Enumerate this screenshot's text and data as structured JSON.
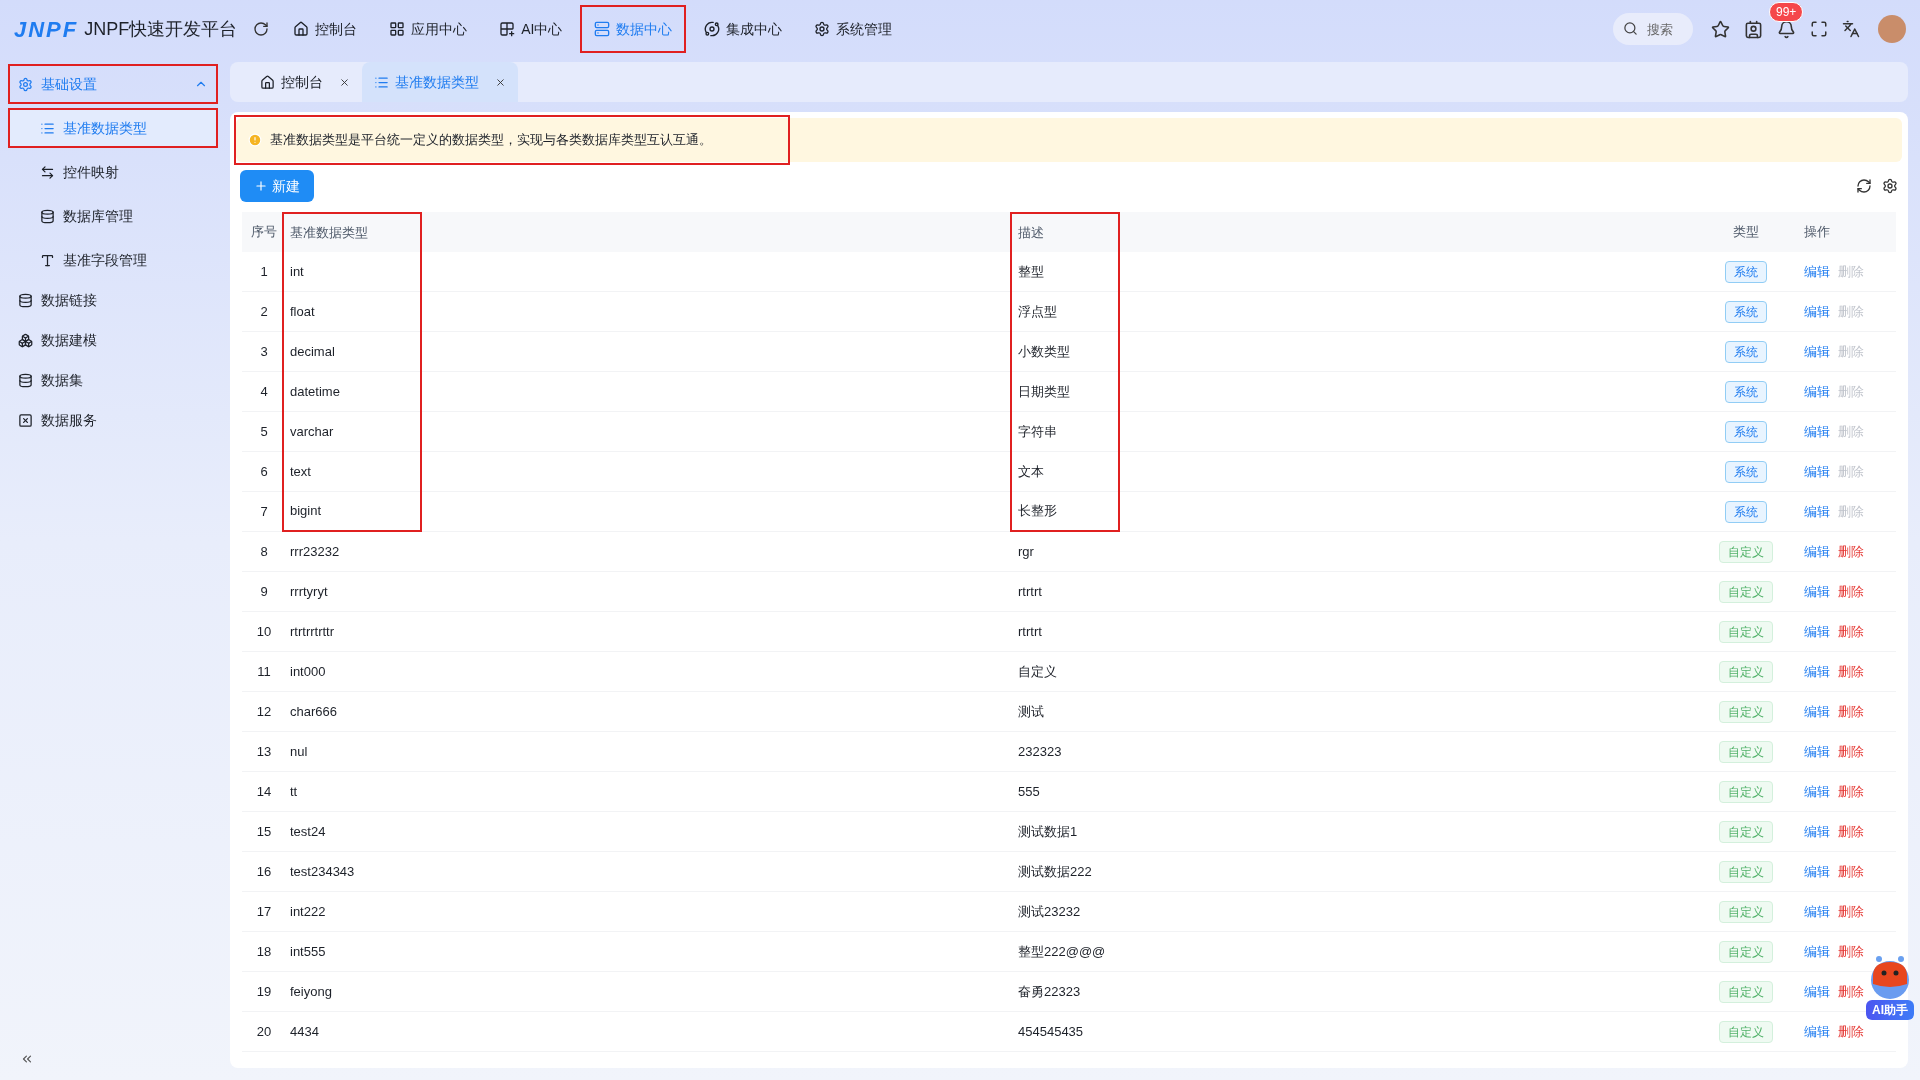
{
  "header": {
    "logo_text": "JNPF",
    "title": "JNPF快速开发平台",
    "search": {
      "placeholder": "搜索"
    },
    "notification_badge": "99+"
  },
  "nav": [
    {
      "label": "控制台",
      "selected": false,
      "highlighted": false
    },
    {
      "label": "应用中心",
      "selected": false,
      "highlighted": false
    },
    {
      "label": "AI中心",
      "selected": false,
      "highlighted": false
    },
    {
      "label": "数据中心",
      "selected": true,
      "highlighted": true
    },
    {
      "label": "集成中心",
      "selected": false,
      "highlighted": false
    },
    {
      "label": "系统管理",
      "selected": false,
      "highlighted": false
    }
  ],
  "sidebar": {
    "items": [
      {
        "label": "基础设置",
        "expanded": true,
        "highlighted": true,
        "children": [
          {
            "label": "基准数据类型",
            "selected": true,
            "highlighted": true
          },
          {
            "label": "控件映射",
            "selected": false,
            "highlighted": false
          },
          {
            "label": "数据库管理",
            "selected": false,
            "highlighted": false
          },
          {
            "label": "基准字段管理",
            "selected": false,
            "highlighted": false
          }
        ]
      },
      {
        "label": "数据链接",
        "highlighted": false
      },
      {
        "label": "数据建模",
        "highlighted": false
      },
      {
        "label": "数据集",
        "highlighted": false
      },
      {
        "label": "数据服务",
        "highlighted": false
      }
    ]
  },
  "tabs": [
    {
      "label": "控制台",
      "selected": false
    },
    {
      "label": "基准数据类型",
      "selected": true
    }
  ],
  "notice": {
    "text": "基准数据类型是平台统一定义的数据类型，实现与各类数据库类型互认互通。",
    "highlighted": true
  },
  "toolbar": {
    "new_button": "新建"
  },
  "table": {
    "columns": [
      {
        "kind": "index",
        "label": "序号"
      },
      {
        "kind": "name",
        "label": "基准数据类型",
        "highlighted": true
      },
      {
        "kind": "desc",
        "label": "描述",
        "highlighted": true
      },
      {
        "kind": "type",
        "label": "类型"
      },
      {
        "kind": "actions",
        "label": "操作"
      }
    ],
    "rows": [
      {
        "index": "1",
        "name": "int",
        "desc": "整型",
        "kind": "system",
        "type": "系统",
        "edit": "编辑",
        "delete": "删除",
        "disabled": true,
        "highlighted": true
      },
      {
        "index": "2",
        "name": "float",
        "desc": "浮点型",
        "kind": "system",
        "type": "系统",
        "edit": "编辑",
        "delete": "删除",
        "disabled": true,
        "highlighted": true
      },
      {
        "index": "3",
        "name": "decimal",
        "desc": "小数类型",
        "kind": "system",
        "type": "系统",
        "edit": "编辑",
        "delete": "删除",
        "disabled": true,
        "highlighted": true
      },
      {
        "index": "4",
        "name": "datetime",
        "desc": "日期类型",
        "kind": "system",
        "type": "系统",
        "edit": "编辑",
        "delete": "删除",
        "disabled": true,
        "highlighted": true
      },
      {
        "index": "5",
        "name": "varchar",
        "desc": "字符串",
        "kind": "system",
        "type": "系统",
        "edit": "编辑",
        "delete": "删除",
        "disabled": true,
        "highlighted": true
      },
      {
        "index": "6",
        "name": "text",
        "desc": "文本",
        "kind": "system",
        "type": "系统",
        "edit": "编辑",
        "delete": "删除",
        "disabled": true,
        "highlighted": true
      },
      {
        "index": "7",
        "name": "bigint",
        "desc": "长整形",
        "kind": "system",
        "type": "系统",
        "edit": "编辑",
        "delete": "删除",
        "disabled": true,
        "highlighted": true
      },
      {
        "index": "8",
        "name": "rrr23232",
        "desc": "rgr",
        "kind": "custom",
        "type": "自定义",
        "edit": "编辑",
        "delete": "删除",
        "disabled": false,
        "highlighted": false
      },
      {
        "index": "9",
        "name": "rrrtyryt",
        "desc": "rtrtrt",
        "kind": "custom",
        "type": "自定义",
        "edit": "编辑",
        "delete": "删除",
        "disabled": false,
        "highlighted": false
      },
      {
        "index": "10",
        "name": "rtrtrrtrttr",
        "desc": "rtrtrt",
        "kind": "custom",
        "type": "自定义",
        "edit": "编辑",
        "delete": "删除",
        "disabled": false,
        "highlighted": false
      },
      {
        "index": "11",
        "name": "int000",
        "desc": "自定义",
        "kind": "custom",
        "type": "自定义",
        "edit": "编辑",
        "delete": "删除",
        "disabled": false,
        "highlighted": false
      },
      {
        "index": "12",
        "name": "char666",
        "desc": "测试",
        "kind": "custom",
        "type": "自定义",
        "edit": "编辑",
        "delete": "删除",
        "disabled": false,
        "highlighted": false
      },
      {
        "index": "13",
        "name": "nul",
        "desc": "232323",
        "kind": "custom",
        "type": "自定义",
        "edit": "编辑",
        "delete": "删除",
        "disabled": false,
        "highlighted": false
      },
      {
        "index": "14",
        "name": "tt",
        "desc": "555",
        "kind": "custom",
        "type": "自定义",
        "edit": "编辑",
        "delete": "删除",
        "disabled": false,
        "highlighted": false
      },
      {
        "index": "15",
        "name": "test24",
        "desc": "测试数据1",
        "kind": "custom",
        "type": "自定义",
        "edit": "编辑",
        "delete": "删除",
        "disabled": false,
        "highlighted": false
      },
      {
        "index": "16",
        "name": "test234343",
        "desc": "测试数据222",
        "kind": "custom",
        "type": "自定义",
        "edit": "编辑",
        "delete": "删除",
        "disabled": false,
        "highlighted": false
      },
      {
        "index": "17",
        "name": "int222",
        "desc": "测试23232",
        "kind": "custom",
        "type": "自定义",
        "edit": "编辑",
        "delete": "删除",
        "disabled": false,
        "highlighted": false
      },
      {
        "index": "18",
        "name": "int555",
        "desc": "整型222@@@",
        "kind": "custom",
        "type": "自定义",
        "edit": "编辑",
        "delete": "删除",
        "disabled": false,
        "highlighted": false
      },
      {
        "index": "19",
        "name": "feiyong",
        "desc": "奋勇22323",
        "kind": "custom",
        "type": "自定义",
        "edit": "编辑",
        "delete": "删除",
        "disabled": false,
        "highlighted": false
      },
      {
        "index": "20",
        "name": "4434",
        "desc": "454545435",
        "kind": "custom",
        "type": "自定义",
        "edit": "编辑",
        "delete": "删除",
        "disabled": false,
        "highlighted": false
      }
    ]
  },
  "assistant": {
    "label": "AI助手"
  }
}
